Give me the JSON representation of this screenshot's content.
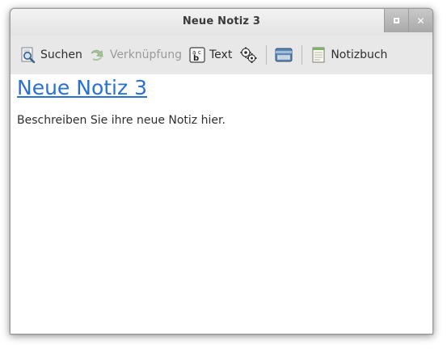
{
  "window": {
    "title": "Neue Notiz 3",
    "controls": [
      "maximize-icon",
      "close-icon"
    ]
  },
  "toolbar": {
    "search_label": "Suchen",
    "link_label": "Verknüpfung",
    "link_enabled": false,
    "text_label": "Text",
    "notebook_label": "Notizbuch"
  },
  "note": {
    "title": "Neue Notiz 3",
    "body": "Beschreiben Sie ihre neue Notiz hier."
  },
  "colors": {
    "link": "#2a6fd6",
    "toolbar_bg": "#e8e8e8",
    "disabled_text": "#9a9a9a"
  }
}
